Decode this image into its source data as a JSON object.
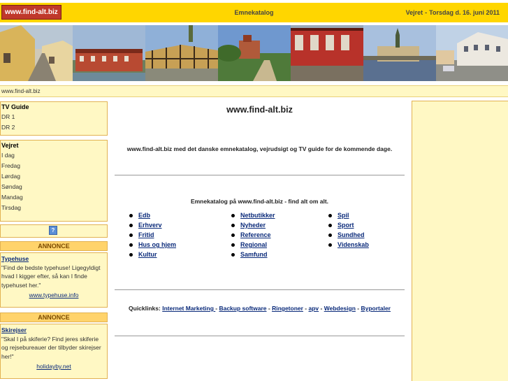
{
  "header": {
    "logo": "www.find-alt.biz",
    "catalog_title": "Emnekatalog",
    "weather_label": "Vejret",
    "date": "Torsdag d. 16. juni 2011"
  },
  "breadcrumb": "www.find-alt.biz",
  "tv_guide": {
    "heading": "TV Guide",
    "items": [
      "DR 1",
      "DR 2"
    ]
  },
  "weather": {
    "heading": "Vejret",
    "items": [
      "I dag",
      "Fredag",
      "Lørdag",
      "Søndag",
      "Mandag",
      "Tirsdag"
    ]
  },
  "help_label": "?",
  "ads": [
    {
      "heading": "ANNONCE",
      "title": "Typehuse",
      "text": "\"Find de bedste typehuse! Ligegyldigt hvad I kigger efter, så kan I finde typehuset her.\"",
      "url": "www.typehuse.info"
    },
    {
      "heading": "ANNONCE",
      "title": "Skirejser",
      "text": "\"Skal I på skiferie? Find jeres skiferie og rejsebureauer der tilbyder skirejser her!\"",
      "url": "holidayby.net"
    }
  ],
  "main": {
    "title": "www.find-alt.biz",
    "intro": "www.find-alt.biz med det danske emnekatalog, vejrudsigt og TV guide for de kommende dage.",
    "catalog_heading": "Emnekatalog på www.find-alt.biz - find alt om alt.",
    "categories": [
      [
        "Edb",
        "Erhverv",
        "Fritid",
        "Hus og hjem",
        "Kultur"
      ],
      [
        "Netbutikker",
        "Nyheder",
        "Reference",
        "Regional",
        "Samfund"
      ],
      [
        "Spil",
        "Sport",
        "Sundhed",
        "Videnskab"
      ]
    ],
    "quicklinks_label": "Quicklinks:",
    "quicklinks": [
      "Internet Marketing ",
      "Backup software",
      "Ringetoner",
      "apv",
      "Webdesign",
      "Byportaler"
    ]
  },
  "colors": {
    "topbar": "#ffd600",
    "logo_bg": "#c0392b",
    "panel_bg": "#fff8c4",
    "panel_border": "#e2b252",
    "link": "#0a2a7a"
  }
}
